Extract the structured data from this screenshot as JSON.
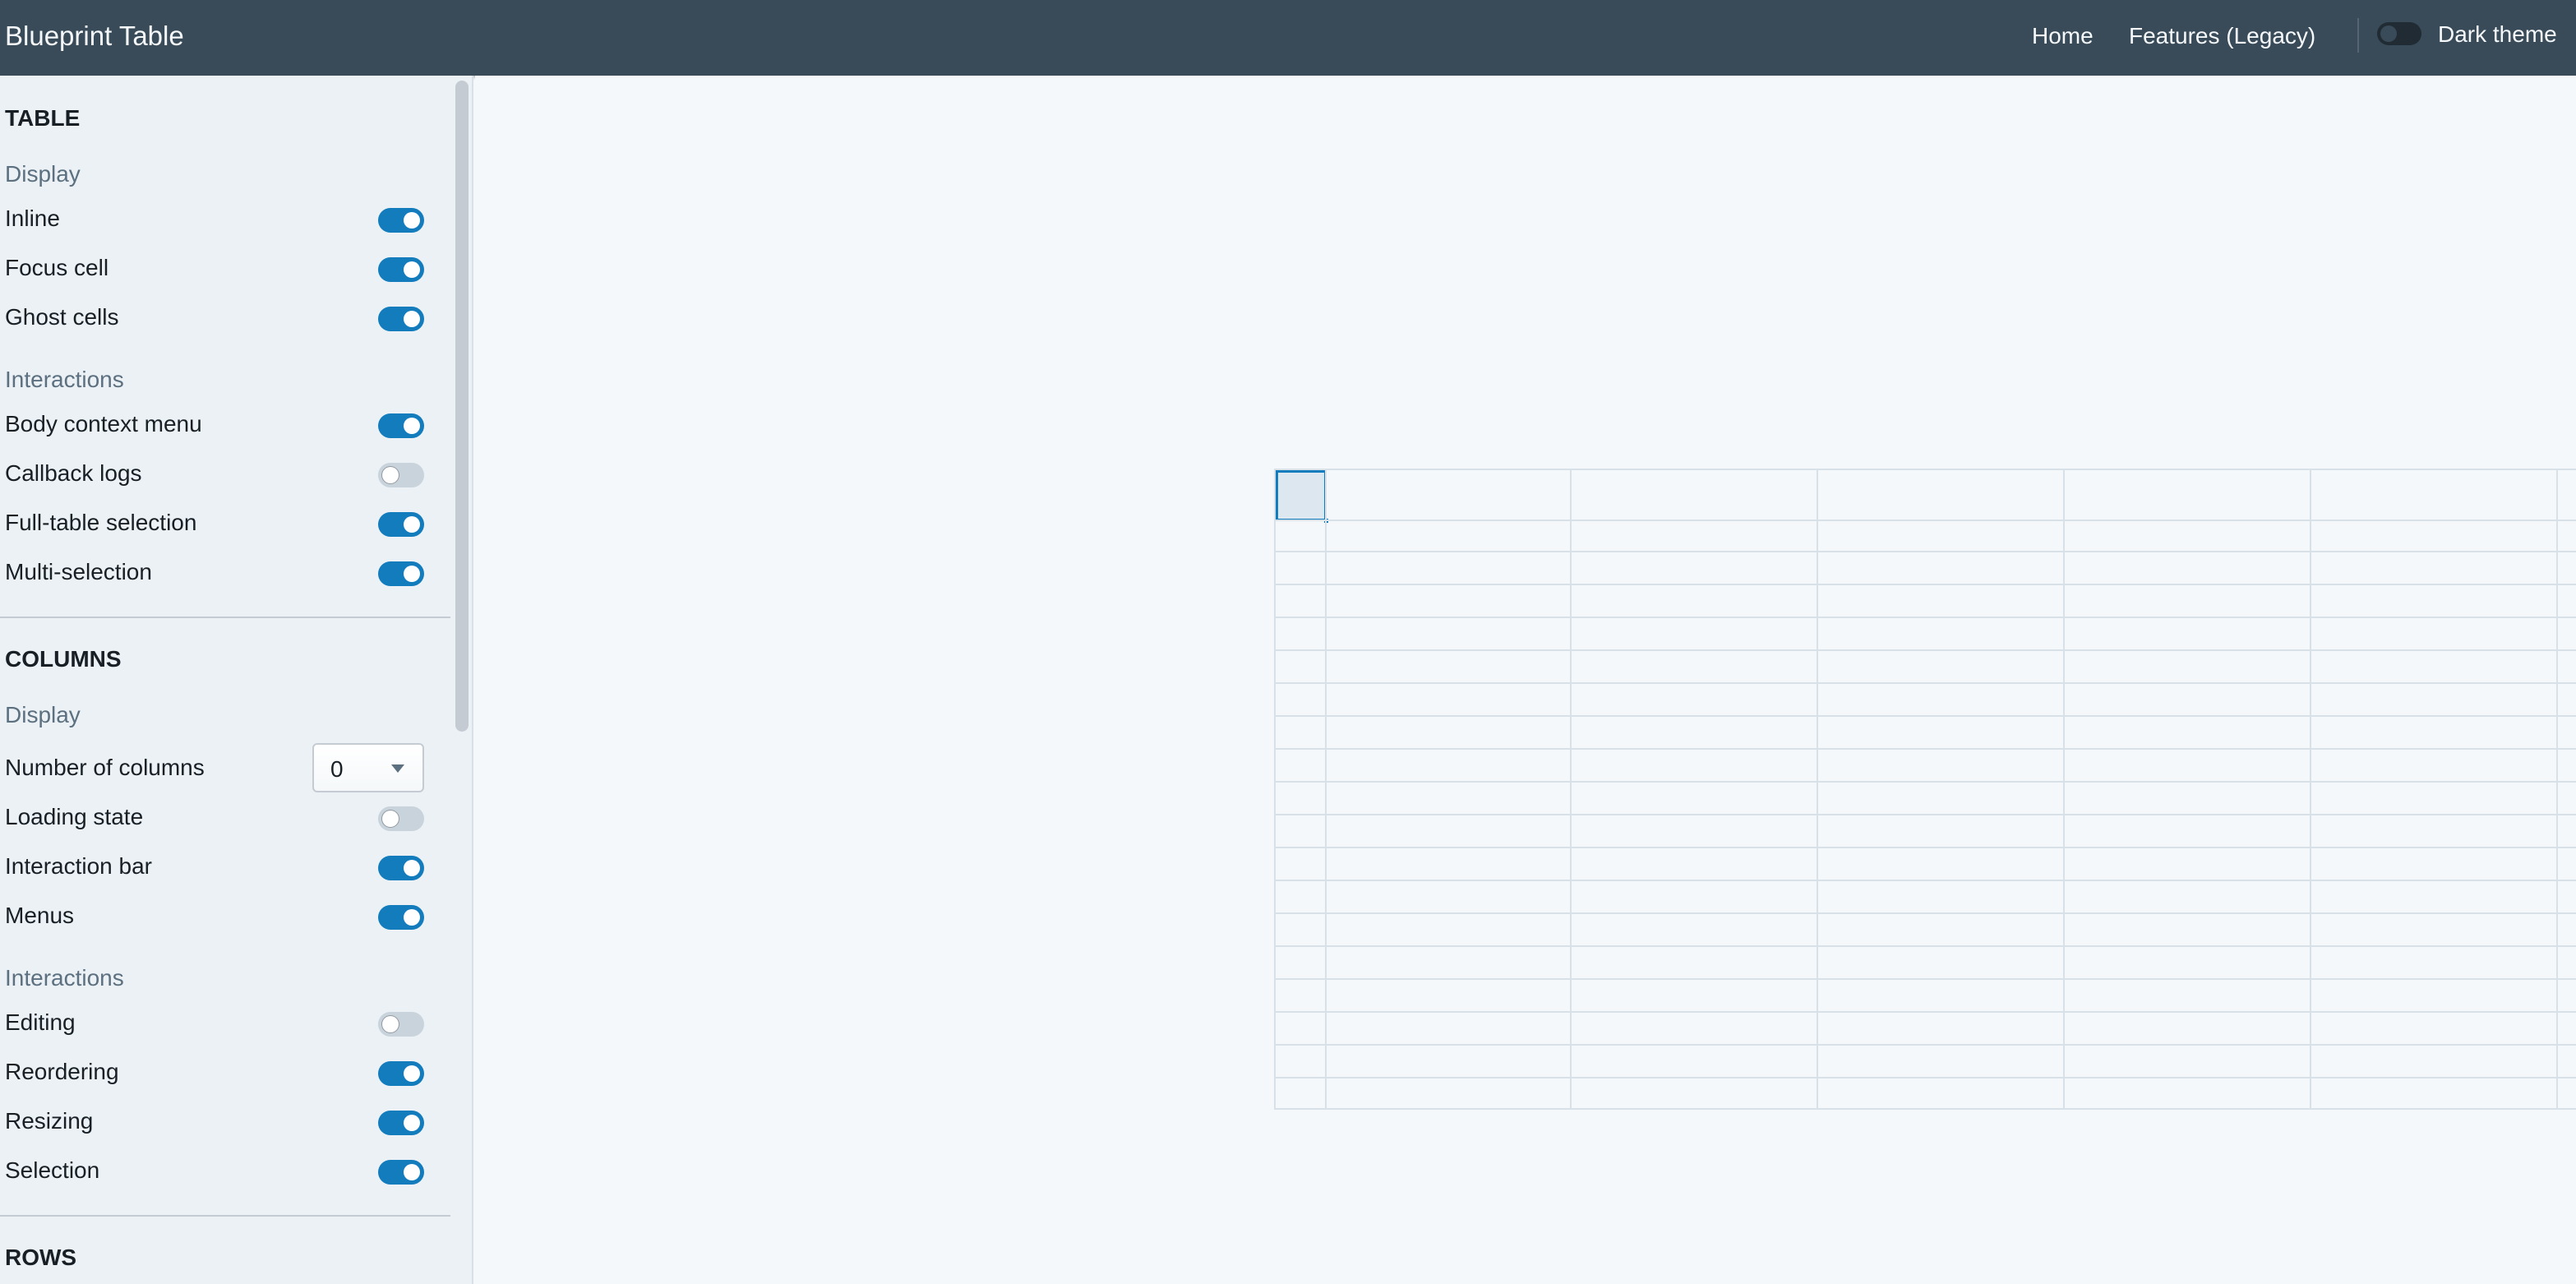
{
  "navbar": {
    "title": "Blueprint Table",
    "links": [
      "Home",
      "Features (Legacy)"
    ],
    "dark_theme_label": "Dark theme",
    "dark_theme_on": false
  },
  "sidebar": {
    "table": {
      "title": "TABLE",
      "display_label": "Display",
      "display_items": [
        {
          "label": "Inline",
          "on": true
        },
        {
          "label": "Focus cell",
          "on": true
        },
        {
          "label": "Ghost cells",
          "on": true
        }
      ],
      "interactions_label": "Interactions",
      "interaction_items": [
        {
          "label": "Body context menu",
          "on": true
        },
        {
          "label": "Callback logs",
          "on": false
        },
        {
          "label": "Full-table selection",
          "on": true
        },
        {
          "label": "Multi-selection",
          "on": true
        }
      ]
    },
    "columns": {
      "title": "COLUMNS",
      "display_label": "Display",
      "number_of_columns_label": "Number of columns",
      "number_of_columns_value": "0",
      "display_items": [
        {
          "label": "Loading state",
          "on": false
        },
        {
          "label": "Interaction bar",
          "on": true
        },
        {
          "label": "Menus",
          "on": true
        }
      ],
      "interactions_label": "Interactions",
      "interaction_items": [
        {
          "label": "Editing",
          "on": false
        },
        {
          "label": "Reordering",
          "on": true
        },
        {
          "label": "Resizing",
          "on": true
        },
        {
          "label": "Selection",
          "on": true
        }
      ]
    },
    "rows": {
      "title": "ROWS"
    }
  },
  "colors": {
    "navbar": "#394b59",
    "accent": "#137cbd",
    "sidebar": "#ebf1f5",
    "background": "#f5f8fa"
  }
}
